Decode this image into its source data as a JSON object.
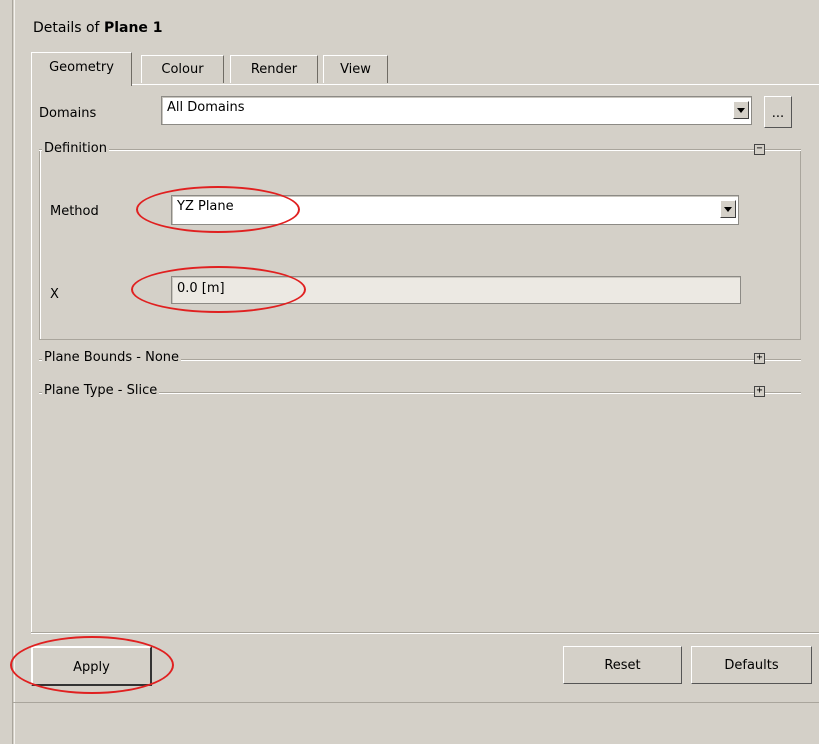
{
  "title": {
    "prefix": "Details of ",
    "object_name": "Plane 1"
  },
  "tabs": [
    {
      "label": "Geometry",
      "active": true
    },
    {
      "label": "Colour",
      "active": false
    },
    {
      "label": "Render",
      "active": false
    },
    {
      "label": "View",
      "active": false
    }
  ],
  "domains": {
    "label": "Domains",
    "value": "All Domains",
    "browse_label": "..."
  },
  "definition": {
    "label": "Definition",
    "toggle": "−",
    "method": {
      "label": "Method",
      "value": "YZ Plane"
    },
    "x": {
      "label": "X",
      "value": "0.0 [m]"
    }
  },
  "plane_bounds": {
    "label": "Plane Bounds - None",
    "toggle": "+"
  },
  "plane_type": {
    "label": "Plane Type - Slice",
    "toggle": "+"
  },
  "buttons": {
    "apply": "Apply",
    "reset": "Reset",
    "defaults": "Defaults"
  },
  "colors": {
    "panel_bg": "#d4d0c8",
    "annotation_red": "#e02020"
  }
}
